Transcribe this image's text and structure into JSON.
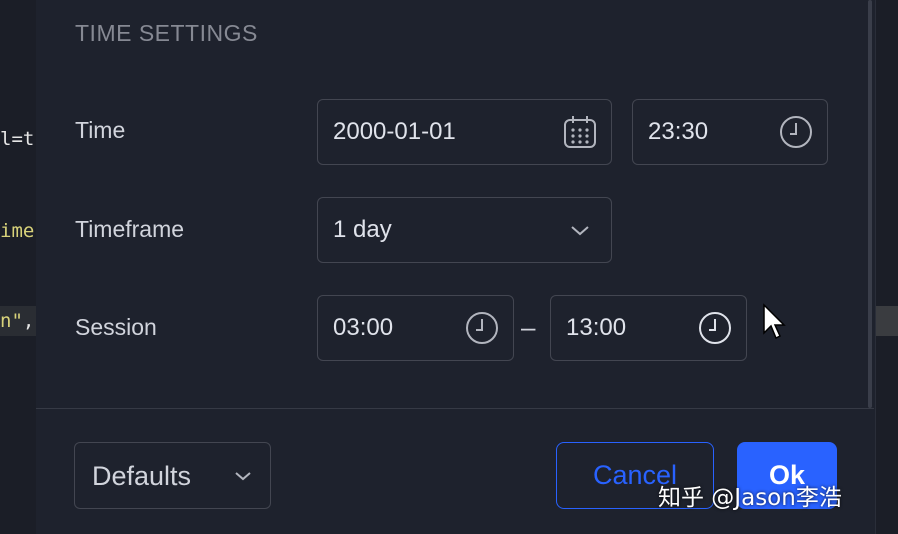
{
  "background": {
    "code_line_1": "l=t",
    "code_line_2": "ime",
    "code_line_3_str": "n\"",
    "code_line_3_tail": ","
  },
  "dialog": {
    "section_title": "TIME SETTINGS",
    "time": {
      "label": "Time",
      "date_value": "2000-01-01",
      "date_icon": "calendar-icon",
      "time_value": "23:30",
      "time_icon": "clock-icon"
    },
    "timeframe": {
      "label": "Timeframe",
      "selected": "1 day",
      "icon": "chevron-down-icon"
    },
    "session": {
      "label": "Session",
      "start": "03:00",
      "separator": "–",
      "end": "13:00",
      "icon": "clock-icon"
    },
    "footer": {
      "defaults_label": "Defaults",
      "cancel_label": "Cancel",
      "ok_label": "Ok"
    }
  },
  "watermark": "知乎 @Jason李浩",
  "colors": {
    "accent": "#2962ff",
    "dialog_bg": "#1e222d",
    "border": "#434651",
    "muted_text": "#868993"
  }
}
